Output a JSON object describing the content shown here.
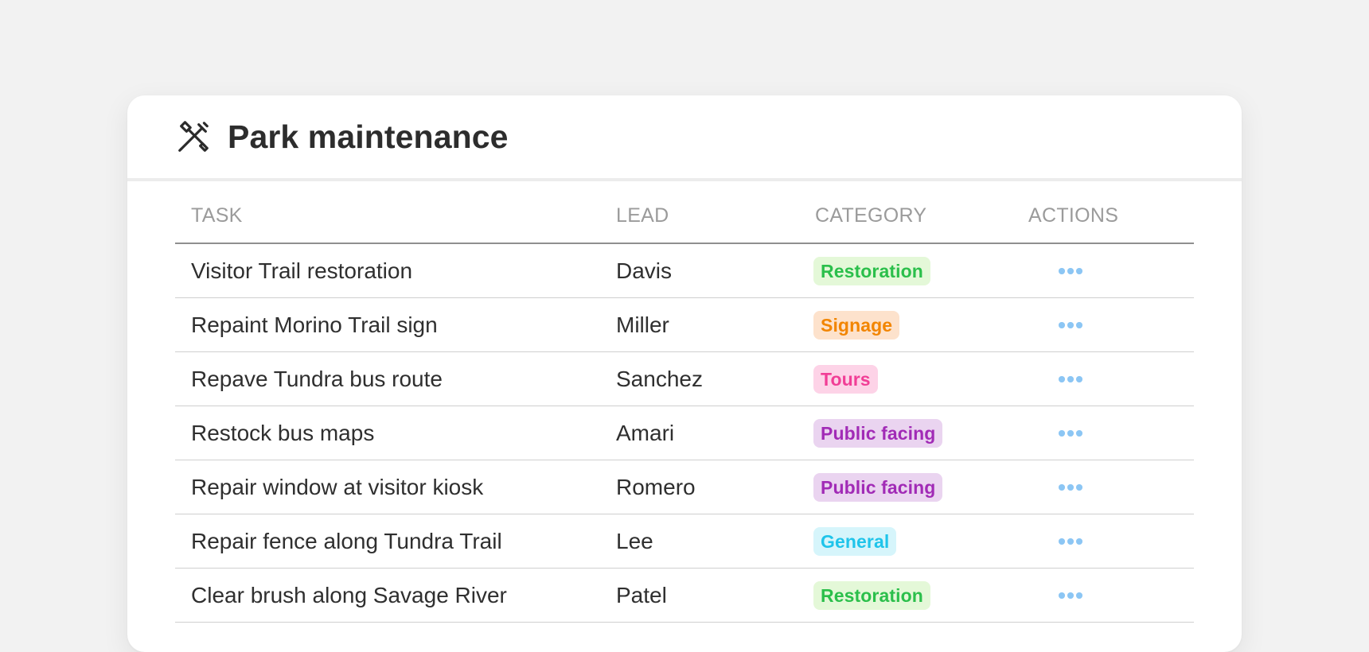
{
  "card": {
    "title": "Park maintenance",
    "icon": "tools-icon"
  },
  "table": {
    "headers": {
      "task": "TASK",
      "lead": "LEAD",
      "category": "CATEGORY",
      "actions": "ACTIONS"
    },
    "rows": [
      {
        "task": "Visitor Trail restoration",
        "lead": "Davis",
        "category": "Restoration"
      },
      {
        "task": "Repaint Morino Trail sign",
        "lead": "Miller",
        "category": "Signage"
      },
      {
        "task": "Repave Tundra bus route",
        "lead": "Sanchez",
        "category": "Tours"
      },
      {
        "task": "Restock bus maps",
        "lead": "Amari",
        "category": "Public facing"
      },
      {
        "task": "Repair window at visitor kiosk",
        "lead": "Romero",
        "category": "Public facing"
      },
      {
        "task": "Repair fence along Tundra Trail",
        "lead": "Lee",
        "category": "General"
      },
      {
        "task": "Clear brush along Savage River",
        "lead": "Patel",
        "category": "Restoration"
      }
    ]
  },
  "category_styles": {
    "Restoration": {
      "text": "#2bbf4b",
      "background": "#e4f8d8"
    },
    "Signage": {
      "text": "#f28500",
      "background": "#fde2cc"
    },
    "Tours": {
      "text": "#f13e96",
      "background": "#fdd3e7"
    },
    "Public facing": {
      "text": "#a12bb6",
      "background": "#ead4f0"
    },
    "General": {
      "text": "#1fc4ea",
      "background": "#d6f5fb"
    }
  },
  "actions_icon": "more-horizontal-icon",
  "background_color": "#f2f2f2",
  "card_color": "#ffffff"
}
